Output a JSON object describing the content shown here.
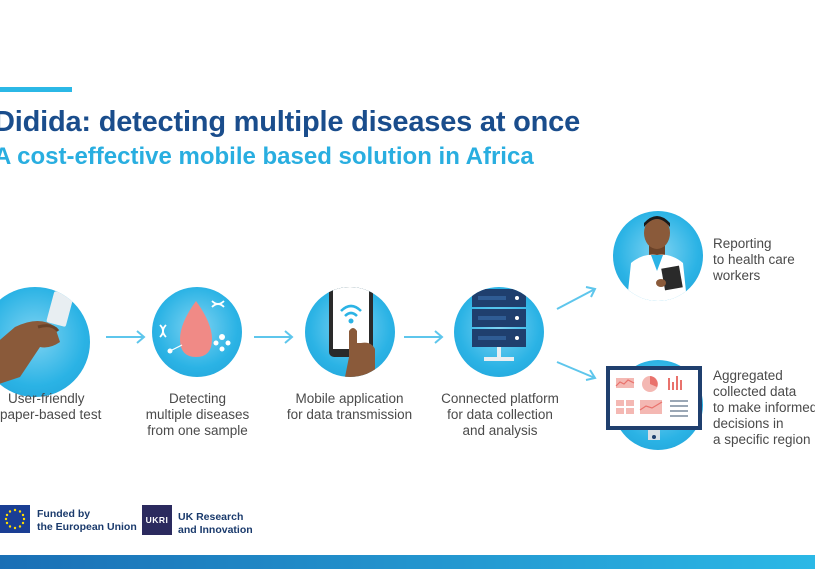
{
  "header": {
    "title": "Didida: detecting multiple diseases at once",
    "subtitle": "A cost-effective mobile based solution in Africa"
  },
  "steps": [
    {
      "lines": [
        "User-friendly",
        "paper-based test"
      ]
    },
    {
      "lines": [
        "Detecting",
        "multiple diseases",
        "from one sample"
      ]
    },
    {
      "lines": [
        "Mobile application",
        "for data transmission"
      ]
    },
    {
      "lines": [
        "Connected platform",
        "for data collection",
        "and analysis"
      ]
    }
  ],
  "outcomes": [
    {
      "lines": [
        "Reporting",
        "to health care",
        "workers"
      ]
    },
    {
      "lines": [
        "Aggregated",
        "collected data",
        "to make informed",
        "decisions in",
        "a specific region"
      ]
    }
  ],
  "footer": {
    "eu_lines": [
      "Funded by",
      "the European Union"
    ],
    "ukri_lines": [
      "UK Research",
      "and Innovation"
    ],
    "ukri_mark": "UKRI"
  },
  "colors": {
    "title": "#1a4d8c",
    "subtitle": "#29aee0",
    "accent": "#2bb8e6",
    "arrow": "#5ec6ec",
    "eu_flag": "#1a3e94"
  }
}
